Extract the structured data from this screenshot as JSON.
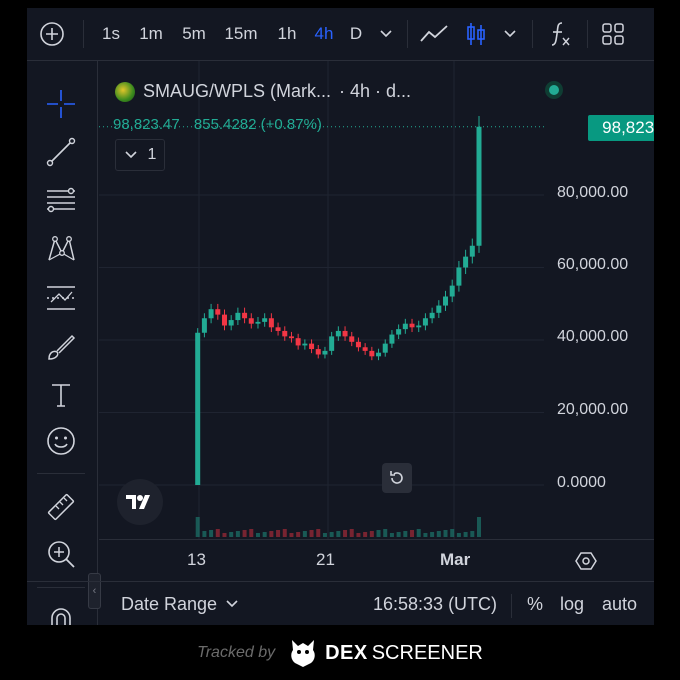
{
  "toolbar": {
    "intervals": [
      "1s",
      "1m",
      "5m",
      "15m",
      "1h",
      "4h",
      "D"
    ],
    "active_interval": "4h"
  },
  "legend": {
    "symbol": "SMAUG/WPLS (Mark...",
    "meta": "· 4h · d...",
    "collapse_count": "1"
  },
  "ohlc": {
    "price": "98,823.47",
    "change": "855.4282 (+0.87%)"
  },
  "price_axis": {
    "labels": [
      "80,000.00",
      "60,000.00",
      "40,000.00",
      "20,000.00",
      "0.0000"
    ],
    "current_price": "98,823.47"
  },
  "time_axis": {
    "labels": [
      "13",
      "21",
      "Mar"
    ]
  },
  "bottom_bar": {
    "date_range": "Date Range",
    "clock": "16:58:33 (UTC)",
    "percent": "%",
    "log": "log",
    "auto": "auto"
  },
  "footer": {
    "tracked_by": "Tracked by",
    "brand_bold": "DEX",
    "brand_light": "SCREENER"
  },
  "colors": {
    "up": "#22ab94",
    "down": "#f23645",
    "background": "#131722",
    "accent": "#2962ff"
  },
  "chart_data": {
    "type": "candlestick",
    "ylim": [
      0,
      105000
    ],
    "close_series": [
      0,
      42000,
      46000,
      48500,
      47000,
      44000,
      45500,
      47500,
      46000,
      44500,
      45000,
      46000,
      43500,
      42500,
      41000,
      40500,
      38500,
      39000,
      37500,
      36000,
      37000,
      41000,
      42500,
      41000,
      39500,
      38000,
      37000,
      35500,
      36500,
      39000,
      41500,
      43000,
      44500,
      43500,
      44000,
      46000,
      47500,
      49500,
      52000,
      55000,
      60000,
      63000,
      66000,
      98823.47
    ]
  }
}
